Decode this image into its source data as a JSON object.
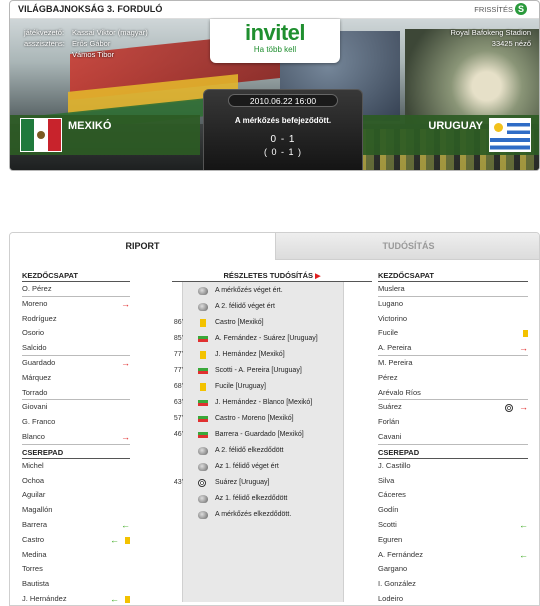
{
  "header": {
    "round_title": "VILÁGBAJNOKSÁG 3. FORDULÓ",
    "refresh_label": "FRISSÍTÉS",
    "referee_label": "játékvezető:",
    "referee_value": "Kassai Viktor (magyar)",
    "assistants_label": "asszisztens:",
    "assistant_1": "Erős Gábor",
    "assistant_2": "Vámos Tibor",
    "stadium": "Royal Bafokeng Stadion",
    "attendance": "33425 néző",
    "logo_text": "invitel",
    "logo_tagline": "Ha több kell",
    "date_time": "2010.06.22 16:00",
    "status": "A mérkőzés befejeződött.",
    "score": "0 - 1",
    "half_score": "( 0 - 1 )",
    "home_team": "MEXIKÓ",
    "away_team": "URUGUAY"
  },
  "tabs": {
    "riport": "RIPORT",
    "tudositas": "TUDÓSÍTÁS"
  },
  "home": {
    "starting_label": "KEZDŐCSAPAT",
    "bench_label": "CSEREPAD",
    "starting": [
      {
        "name": "O. Pérez",
        "events": []
      },
      {
        "name": "Moreno",
        "events": [
          "out"
        ]
      },
      {
        "name": "Rodríguez",
        "events": []
      },
      {
        "name": "Osorio",
        "events": []
      },
      {
        "name": "Salcido",
        "events": []
      },
      {
        "name": "Guardado",
        "events": [
          "out"
        ]
      },
      {
        "name": "Márquez",
        "events": []
      },
      {
        "name": "Torrado",
        "events": []
      },
      {
        "name": "Giovani",
        "events": []
      },
      {
        "name": "G. Franco",
        "events": []
      },
      {
        "name": "Blanco",
        "events": [
          "out"
        ]
      }
    ],
    "bench": [
      {
        "name": "Michel",
        "events": []
      },
      {
        "name": "Ochoa",
        "events": []
      },
      {
        "name": "Aguilar",
        "events": []
      },
      {
        "name": "Magallón",
        "events": []
      },
      {
        "name": "Barrera",
        "events": [
          "in"
        ]
      },
      {
        "name": "Castro",
        "events": [
          "in",
          "yellow"
        ]
      },
      {
        "name": "Medina",
        "events": []
      },
      {
        "name": "Torres",
        "events": []
      },
      {
        "name": "Bautista",
        "events": []
      },
      {
        "name": "J. Hernández",
        "events": [
          "in",
          "yellow"
        ]
      }
    ]
  },
  "away": {
    "starting_label": "KEZDŐCSAPAT",
    "bench_label": "CSEREPAD",
    "starting": [
      {
        "name": "Muslera",
        "events": []
      },
      {
        "name": "Lugano",
        "events": []
      },
      {
        "name": "Victorino",
        "events": []
      },
      {
        "name": "Fucile",
        "events": [
          "yellow"
        ]
      },
      {
        "name": "A. Pereira",
        "events": [
          "out"
        ]
      },
      {
        "name": "M. Pereira",
        "events": []
      },
      {
        "name": "Pérez",
        "events": []
      },
      {
        "name": "Arévalo Ríos",
        "events": []
      },
      {
        "name": "Suárez",
        "events": [
          "goal",
          "out"
        ]
      },
      {
        "name": "Forlán",
        "events": []
      },
      {
        "name": "Cavani",
        "events": []
      }
    ],
    "bench": [
      {
        "name": "J. Castillo",
        "events": []
      },
      {
        "name": "Silva",
        "events": []
      },
      {
        "name": "Cáceres",
        "events": []
      },
      {
        "name": "Godín",
        "events": []
      },
      {
        "name": "Scotti",
        "events": [
          "in"
        ]
      },
      {
        "name": "Eguren",
        "events": []
      },
      {
        "name": "A. Fernández",
        "events": [
          "in"
        ]
      },
      {
        "name": "Gargano",
        "events": []
      },
      {
        "name": "I. González",
        "events": []
      },
      {
        "name": "Lodeiro",
        "events": []
      }
    ]
  },
  "feed": {
    "title": "RÉSZLETES TUDÓSÍTÁS",
    "events": [
      {
        "minute": "",
        "icon": "whistle",
        "text": "A mérkőzés véget ért."
      },
      {
        "minute": "",
        "icon": "whistle",
        "text": "A 2. félidő véget ért"
      },
      {
        "minute": "86'",
        "icon": "yellow-card",
        "text": "Castro [Mexikó]"
      },
      {
        "minute": "85'",
        "icon": "substitution",
        "text": "A. Fernández - Suárez [Uruguay]"
      },
      {
        "minute": "77'",
        "icon": "yellow-card",
        "text": "J. Hernández [Mexikó]"
      },
      {
        "minute": "77'",
        "icon": "substitution",
        "text": "Scotti - A. Pereira [Uruguay]"
      },
      {
        "minute": "68'",
        "icon": "yellow-card",
        "text": "Fucile [Uruguay]"
      },
      {
        "minute": "63'",
        "icon": "substitution",
        "text": "J. Hernández - Blanco [Mexikó]"
      },
      {
        "minute": "57'",
        "icon": "substitution",
        "text": "Castro - Moreno [Mexikó]"
      },
      {
        "minute": "46'",
        "icon": "substitution",
        "text": "Barrera - Guardado [Mexikó]"
      },
      {
        "minute": "",
        "icon": "whistle",
        "text": "A 2. félidő elkezdődött"
      },
      {
        "minute": "",
        "icon": "whistle",
        "text": "Az 1. félidő véget ért"
      },
      {
        "minute": "43'",
        "icon": "goal",
        "text": "Suárez [Uruguay]"
      },
      {
        "minute": "",
        "icon": "whistle",
        "text": "Az 1. félidő elkezdődött"
      },
      {
        "minute": "",
        "icon": "whistle",
        "text": "A mérkőzés elkezdődött."
      }
    ]
  }
}
